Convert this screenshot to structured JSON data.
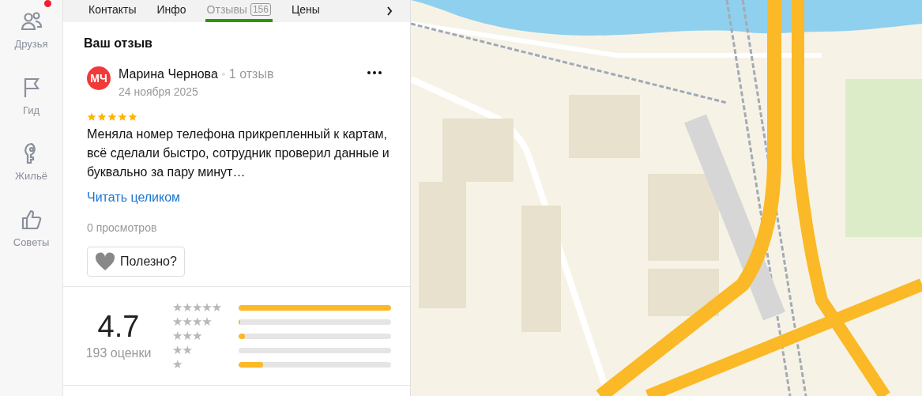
{
  "sidebar": {
    "items": [
      {
        "kind": "friends",
        "label": "Друзья",
        "badge": true
      },
      {
        "kind": "guide",
        "label": "Гид"
      },
      {
        "kind": "housing",
        "label": "Жильё"
      },
      {
        "kind": "tips",
        "label": "Советы"
      }
    ]
  },
  "tabs": [
    {
      "label": "Контакты",
      "selected": false
    },
    {
      "label": "Инфо",
      "selected": false
    },
    {
      "label": "Отзывы",
      "count": "156",
      "selected": true
    },
    {
      "label": "Цены",
      "selected": false
    }
  ],
  "your_review": {
    "heading": "Ваш отзыв",
    "author": {
      "initials": "МЧ",
      "name": "Марина Чернова",
      "reviews": "1 отзыв"
    },
    "date": "24 ноября 2025",
    "stars": 5,
    "text": "Меняла номер телефона прикрепленный к картам, всё сделали быстро, сотрудник проверил данные и буквально за пару минут…",
    "read_more": "Читать целиком",
    "views": "0 просмотров",
    "helpful": "Полезно?"
  },
  "rating": {
    "value": "4.7",
    "count": "193 оценки",
    "bars": [
      {
        "label": "★★★★★",
        "level": 1.0
      },
      {
        "label": "★★★★",
        "level": 0.01
      },
      {
        "label": "★★★",
        "level": 0.04
      },
      {
        "label": "★★",
        "level": 0
      },
      {
        "label": "★",
        "level": 0.16
      }
    ]
  }
}
